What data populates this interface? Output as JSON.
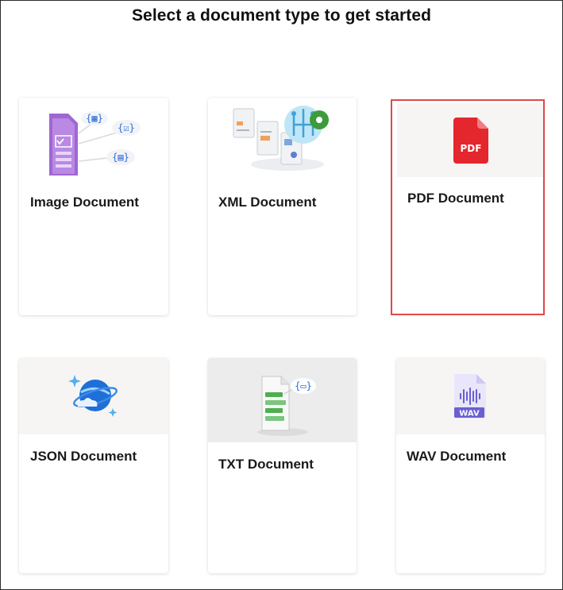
{
  "page": {
    "title": "Select a document type to get started"
  },
  "selected_card": "PDF Document",
  "cards": [
    {
      "label": "Image Document",
      "icon": "image-document-illustration"
    },
    {
      "label": "XML Document",
      "icon": "xml-document-illustration"
    },
    {
      "label": "PDF Document",
      "icon": "pdf-file-icon",
      "icon_text": "PDF"
    },
    {
      "label": "JSON Document",
      "icon": "cosmos-db-planet-icon"
    },
    {
      "label": "TXT Document",
      "icon": "txt-document-illustration"
    },
    {
      "label": "WAV Document",
      "icon": "wav-file-icon",
      "icon_text": "WAV"
    }
  ],
  "colors": {
    "selection_outline": "#e0474c",
    "pdf_red": "#e4262d",
    "wav_purple": "#6b5fd1",
    "art_background": "#f6f5f4"
  }
}
